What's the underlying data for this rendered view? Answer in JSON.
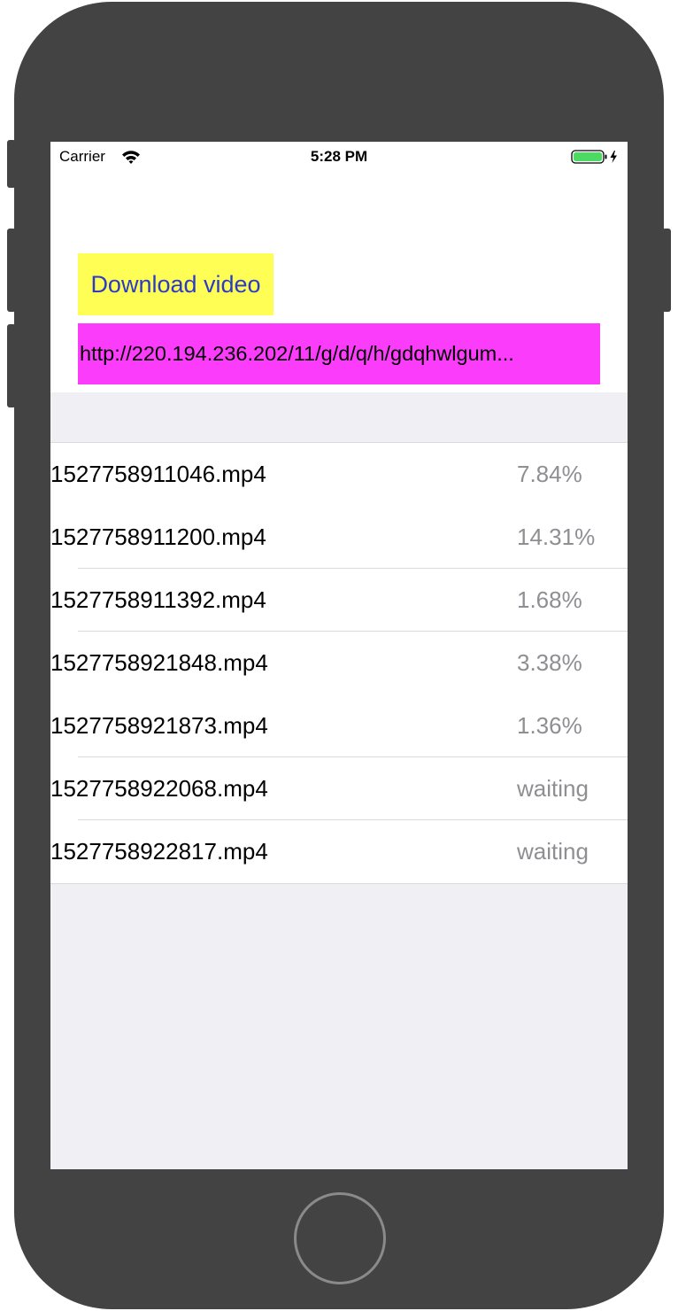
{
  "status_bar": {
    "carrier": "Carrier",
    "time": "5:28 PM",
    "icons": [
      "wifi-icon",
      "battery-icon",
      "charging-bolt-icon"
    ],
    "battery_color": "#4cd964"
  },
  "header": {
    "download_button_label": "Download video",
    "url_text": "http://220.194.236.202/11/g/d/q/h/gdqhwlgum...",
    "colors": {
      "download_button_bg": "#fffe55",
      "download_button_text": "#2b3bc5",
      "url_field_bg": "#fb3dfb"
    }
  },
  "downloads": [
    {
      "name": "1527758911046.mp4",
      "status": "7.84%"
    },
    {
      "name": "1527758911200.mp4",
      "status": "14.31%"
    },
    {
      "name": "1527758911392.mp4",
      "status": "1.68%"
    },
    {
      "name": "1527758921848.mp4",
      "status": "3.38%"
    },
    {
      "name": "1527758921873.mp4",
      "status": "1.36%"
    },
    {
      "name": "1527758922068.mp4",
      "status": "waiting"
    },
    {
      "name": "1527758922817.mp4",
      "status": "waiting"
    }
  ]
}
